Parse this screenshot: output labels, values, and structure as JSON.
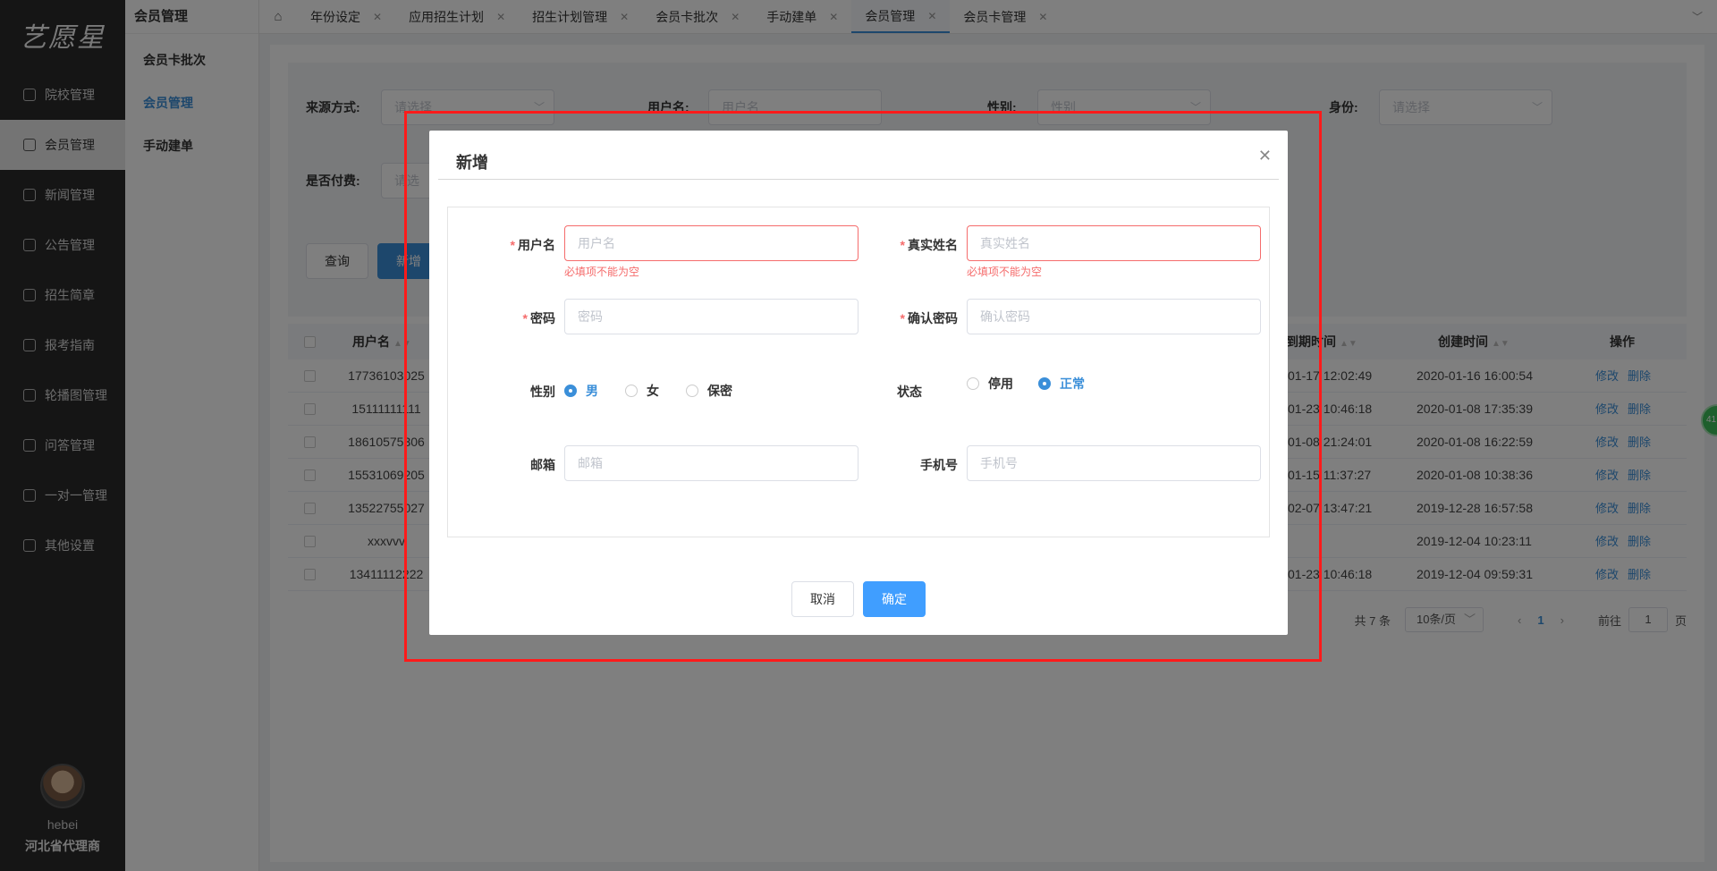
{
  "app": {
    "logo": "艺愿星"
  },
  "sidebar": {
    "items": [
      {
        "label": "院校管理",
        "icon": "gear-icon"
      },
      {
        "label": "会员管理",
        "icon": "shirt-icon"
      },
      {
        "label": "新闻管理",
        "icon": "news-icon"
      },
      {
        "label": "公告管理",
        "icon": "announcement-icon"
      },
      {
        "label": "招生简章",
        "icon": "document-icon"
      },
      {
        "label": "报考指南",
        "icon": "guide-icon"
      },
      {
        "label": "轮播图管理",
        "icon": "image-icon"
      },
      {
        "label": "问答管理",
        "icon": "edit-icon"
      },
      {
        "label": "一对一管理",
        "icon": "pin-icon"
      },
      {
        "label": "其他设置",
        "icon": "settings-icon"
      }
    ],
    "user": {
      "name": "hebei",
      "role": "河北省代理商"
    }
  },
  "submenu": {
    "title": "会员管理",
    "items": [
      "会员卡批次",
      "会员管理",
      "手动建单"
    ]
  },
  "tabs": [
    {
      "label": "年份设定"
    },
    {
      "label": "应用招生计划"
    },
    {
      "label": "招生计划管理"
    },
    {
      "label": "会员卡批次"
    },
    {
      "label": "手动建单"
    },
    {
      "label": "会员管理"
    },
    {
      "label": "会员卡管理"
    }
  ],
  "filter": {
    "source_label": "来源方式:",
    "source_placeholder": "请选择",
    "username_label": "用户名:",
    "username_placeholder": "用户名",
    "gender_label": "性别:",
    "gender_placeholder": "性别",
    "identity_label": "身份:",
    "identity_placeholder": "请选择",
    "paid_label": "是否付费:",
    "paid_placeholder": "请选",
    "query_button": "查询",
    "add_button": "新增"
  },
  "table": {
    "columns": {
      "username": "用户名",
      "expire": "到期时间",
      "created": "创建时间",
      "actions": "操作"
    },
    "rows": [
      {
        "username": "17736103025",
        "expire": "01-17 12:02:49",
        "created": "2020-01-16 16:00:54"
      },
      {
        "username": "15111111111",
        "expire": "01-23 10:46:18",
        "created": "2020-01-08 17:35:39"
      },
      {
        "username": "18610575306",
        "expire": "01-08 21:24:01",
        "created": "2020-01-08 16:22:59"
      },
      {
        "username": "15531069205",
        "expire": "01-15 11:37:27",
        "created": "2020-01-08 10:38:36"
      },
      {
        "username": "13522755027",
        "expire": "02-07 13:47:21",
        "created": "2019-12-28 16:57:58"
      },
      {
        "username": "xxxvvv",
        "expire": "",
        "created": "2019-12-04 10:23:11"
      },
      {
        "username": "13411112222",
        "expire": "01-23 10:46:18",
        "created": "2019-12-04 09:59:31"
      }
    ],
    "edit_label": "修改",
    "delete_label": "删除"
  },
  "pager": {
    "total": "共 7 条",
    "page_size": "10条/页",
    "current": "1",
    "goto_label": "前往",
    "goto_value": "1",
    "page_suffix": "页"
  },
  "float_badge": "41",
  "modal": {
    "title": "新增",
    "username_label": "用户名",
    "username_placeholder": "用户名",
    "username_error": "必填项不能为空",
    "realname_label": "真实姓名",
    "realname_placeholder": "真实姓名",
    "realname_error": "必填项不能为空",
    "password_label": "密码",
    "password_placeholder": "密码",
    "confirm_label": "确认密码",
    "confirm_placeholder": "确认密码",
    "gender_label": "性别",
    "gender_options": [
      "男",
      "女",
      "保密"
    ],
    "gender_selected": "男",
    "status_label": "状态",
    "status_options": [
      "停用",
      "正常"
    ],
    "status_selected": "正常",
    "email_label": "邮箱",
    "email_placeholder": "邮箱",
    "phone_label": "手机号",
    "phone_placeholder": "手机号",
    "cancel_button": "取消",
    "confirm_button": "确定"
  },
  "colors": {
    "primary": "#3b8fd9",
    "error": "#f56c6c",
    "sidebar": "#2b2b2b",
    "highlight_box": "#ff1a1a"
  }
}
